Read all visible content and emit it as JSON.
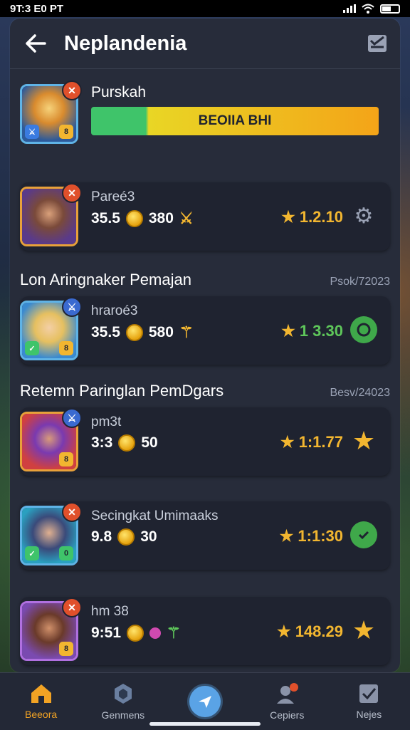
{
  "status": {
    "time": "9T:3 E0 PT"
  },
  "header": {
    "title": "Neplandenia"
  },
  "progress": {
    "label": "Purskah",
    "bar_text": "BEOIIA BHI",
    "fill_fraction": 1.0
  },
  "players": [
    {
      "name": "Pareé3",
      "score": "35.5",
      "coins": "380",
      "rating": "1.2.10",
      "rating_color": "#f2b630"
    },
    {
      "name": "hraroé3",
      "score": "35.5",
      "coins": "580",
      "rating": "1 3.30",
      "rating_color": "#f2b630"
    },
    {
      "name": "pm3t",
      "score": "3:3",
      "coins": "50",
      "rating": "1:1.77",
      "rating_color": "#f2b630"
    },
    {
      "name": "Secingkat Umimaaks",
      "score": "9.8",
      "coins": "30",
      "rating": "1:1:30",
      "rating_color": "#f2b630"
    },
    {
      "name": "hm 38",
      "score": "9:51",
      "coins": "",
      "rating": "148.29",
      "rating_color": "#f2b630"
    }
  ],
  "sections": [
    {
      "title": "Lon Aringnaker Pemajan",
      "date": "Psok/72023"
    },
    {
      "title": "Retemn Paringlan PemDgars",
      "date": "Besv/24023"
    }
  ],
  "tabs": [
    {
      "label": "Beeora",
      "icon": "home-icon"
    },
    {
      "label": "Genmens",
      "icon": "shield-icon"
    },
    {
      "label": "",
      "icon": "send-icon"
    },
    {
      "label": "Cepiers",
      "icon": "profile-icon"
    },
    {
      "label": "Nejes",
      "icon": "check-icon"
    }
  ],
  "colors": {
    "accent": "#f2a324",
    "card": "#1f2330",
    "bar_green": "#3fc46a",
    "bar_yellow": "#f4a418"
  }
}
